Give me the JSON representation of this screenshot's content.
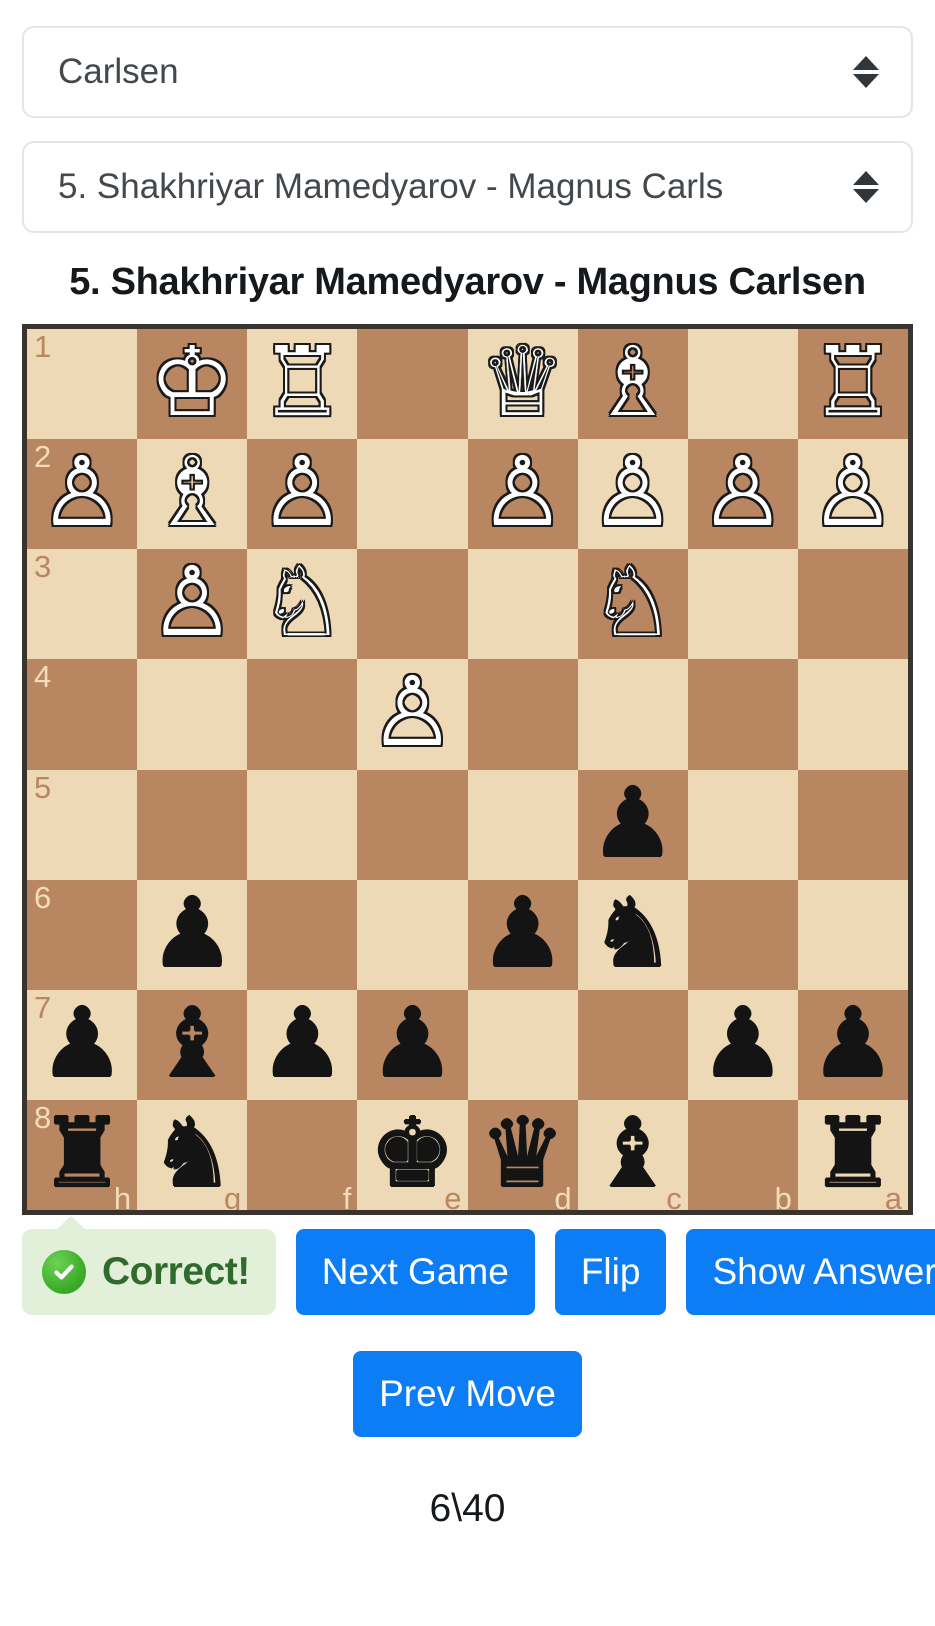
{
  "player_select": {
    "value": "Carlsen",
    "icon": "select-arrows-icon"
  },
  "game_select": {
    "value": "5. Shakhriyar Mamedyarov - Magnus Carls",
    "icon": "select-arrows-icon"
  },
  "game_title": "5. Shakhriyar Mamedyarov - Magnus Carlsen",
  "board": {
    "flipped": true,
    "colors": {
      "light_square": "#eed9b6",
      "dark_square": "#b88762",
      "border": "#3a342f"
    },
    "file_labels": [
      "h",
      "g",
      "f",
      "e",
      "d",
      "c",
      "b",
      "a"
    ],
    "rank_labels": [
      "1",
      "2",
      "3",
      "4",
      "5",
      "6",
      "7",
      "8"
    ],
    "rows": [
      [
        "",
        "wk",
        "wr",
        "",
        "wq",
        "wb",
        "",
        "wr"
      ],
      [
        "wp",
        "wb",
        "wp",
        "",
        "wp",
        "wp",
        "wp",
        "wp"
      ],
      [
        "",
        "wp",
        "wn",
        "",
        "",
        "wn",
        "",
        ""
      ],
      [
        "",
        "",
        "",
        "wp",
        "",
        "",
        "",
        ""
      ],
      [
        "",
        "",
        "",
        "",
        "",
        "bp",
        "",
        ""
      ],
      [
        "",
        "bp",
        "",
        "",
        "bp",
        "bn",
        "",
        ""
      ],
      [
        "bp",
        "bb",
        "bp",
        "bp",
        "",
        "",
        "bp",
        "bp"
      ],
      [
        "br",
        "bn",
        "",
        "bk",
        "bq",
        "bb",
        "",
        "br"
      ]
    ],
    "glyphs": {
      "wk": "♔",
      "wq": "♕",
      "wr": "♖",
      "wb": "♗",
      "wn": "♘",
      "wp": "♙",
      "bk": "♚",
      "bq": "♛",
      "br": "♜",
      "bb": "♝",
      "bn": "♞",
      "bp": "♟"
    }
  },
  "feedback": {
    "text": "Correct!",
    "icon": "check-circle-icon",
    "bg_color": "#e2efd9",
    "text_color": "#2f6b2c",
    "icon_color": "#3fb02b"
  },
  "buttons": {
    "next_game": "Next Game",
    "flip": "Flip",
    "show_answer": "Show Answer",
    "prev_move": "Prev Move",
    "color": "#0d7df5"
  },
  "counter": "6\\40"
}
